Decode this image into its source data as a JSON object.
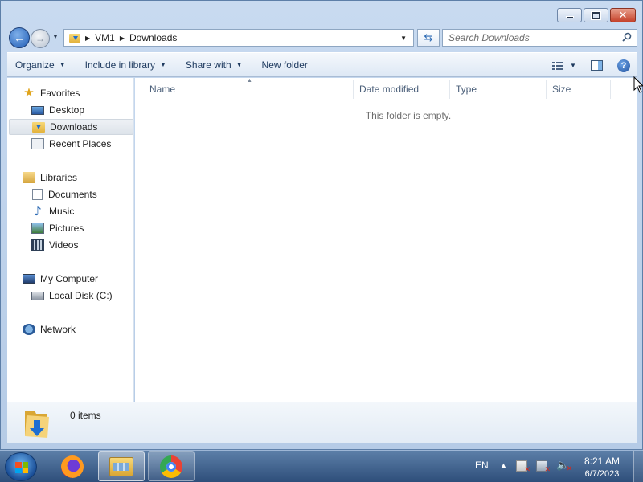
{
  "window": {
    "minimize_label": "",
    "maximize_label": "",
    "close_label": "✕"
  },
  "nav": {
    "breadcrumbs": [
      "VM1",
      "Downloads"
    ],
    "search_placeholder": "Search Downloads"
  },
  "toolbar": {
    "organize": "Organize",
    "include_in_library": "Include in library",
    "share_with": "Share with",
    "new_folder": "New folder"
  },
  "sidebar": {
    "favorites": {
      "label": "Favorites",
      "items": [
        "Desktop",
        "Downloads",
        "Recent Places"
      ],
      "selected": "Downloads"
    },
    "libraries": {
      "label": "Libraries",
      "items": [
        "Documents",
        "Music",
        "Pictures",
        "Videos"
      ]
    },
    "computer": {
      "label": "My Computer",
      "items": [
        "Local Disk (C:)"
      ]
    },
    "network": {
      "label": "Network"
    }
  },
  "content": {
    "columns": [
      "Name",
      "Date modified",
      "Type",
      "Size"
    ],
    "empty_message": "This folder is empty."
  },
  "details": {
    "item_count": "0 items"
  },
  "taskbar": {
    "apps": [
      "firefox-icon",
      "windows-explorer-icon",
      "chrome-icon"
    ],
    "active_app": "windows-explorer-icon",
    "language": "EN",
    "time": "8:21 AM",
    "date": "6/7/2023"
  },
  "colors": {
    "window_frame": "#b5cbe6",
    "taskbar": "#2e4e7a",
    "selection": "#dde3ea",
    "link_text": "#1e3a5f"
  }
}
